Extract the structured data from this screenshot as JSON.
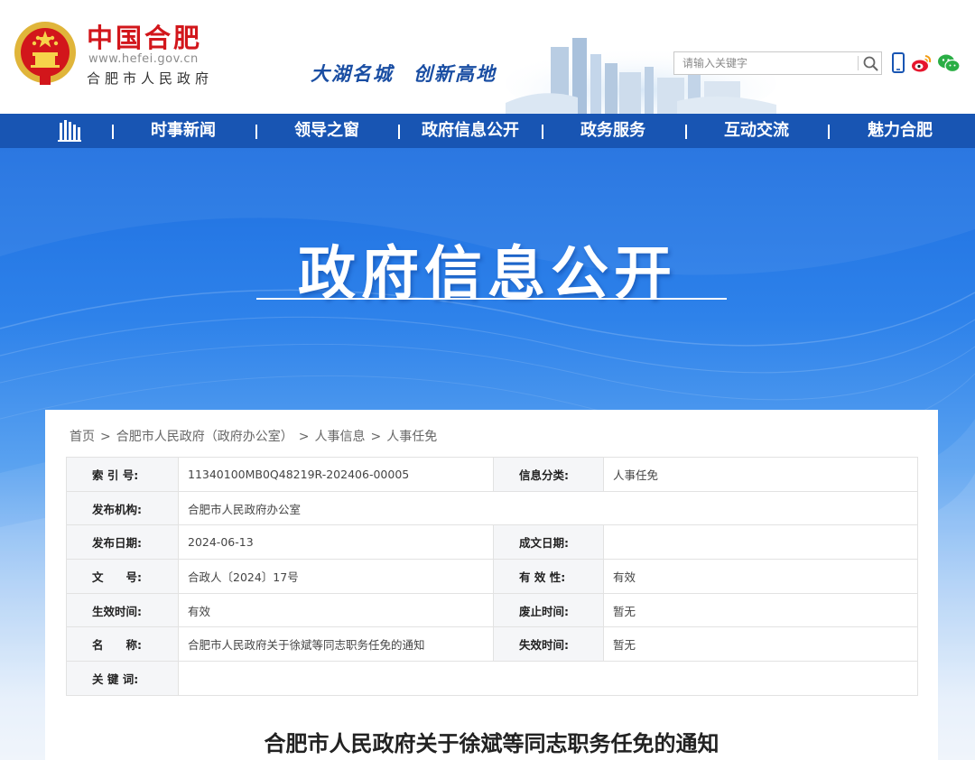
{
  "header": {
    "logo_title": "中国合肥",
    "logo_url": "www.hefei.gov.cn",
    "logo_subtitle": "合肥市人民政府",
    "slogan_left": "大湖名城",
    "slogan_right": "创新高地",
    "search_placeholder": "请输入关键字",
    "icons": [
      "national-emblem-icon",
      "search-icon",
      "mobile-icon",
      "weibo-icon",
      "wechat-icon"
    ]
  },
  "nav": {
    "home_icon": "home-building-icon",
    "items": [
      "时事新闻",
      "领导之窗",
      "政府信息公开",
      "政务服务",
      "互动交流",
      "魅力合肥"
    ]
  },
  "banner": {
    "title": "政府信息公开"
  },
  "breadcrumb": [
    "首页",
    "合肥市人民政府（政府办公室）",
    "人事信息",
    "人事任免"
  ],
  "meta": {
    "index_label": "索 引 号:",
    "index_value": "11340100MB0Q48219R-202406-00005",
    "category_label": "信息分类:",
    "category_value": "人事任免",
    "publisher_label": "发布机构:",
    "publisher_value": "合肥市人民政府办公室",
    "publish_date_label": "发布日期:",
    "publish_date_value": "2024-06-13",
    "written_date_label": "成文日期:",
    "written_date_value": "",
    "doc_no_label": "文　　号:",
    "doc_no_value": "合政人〔2024〕17号",
    "validity_label": "有 效 性:",
    "validity_value": "有效",
    "effective_label": "生效时间:",
    "effective_value": "有效",
    "repeal_label": "废止时间:",
    "repeal_value": "暂无",
    "name_label": "名　　称:",
    "name_value": "合肥市人民政府关于徐斌等同志职务任免的通知",
    "expire_label": "失效时间:",
    "expire_value": "暂无",
    "keywords_label": "关 键 词:",
    "keywords_value": ""
  },
  "document": {
    "title": "合肥市人民政府关于徐斌等同志职务任免的通知"
  },
  "colors": {
    "brand_red": "#d2161b",
    "nav_blue": "#1855b3",
    "slogan_blue": "#1a4ea3"
  }
}
